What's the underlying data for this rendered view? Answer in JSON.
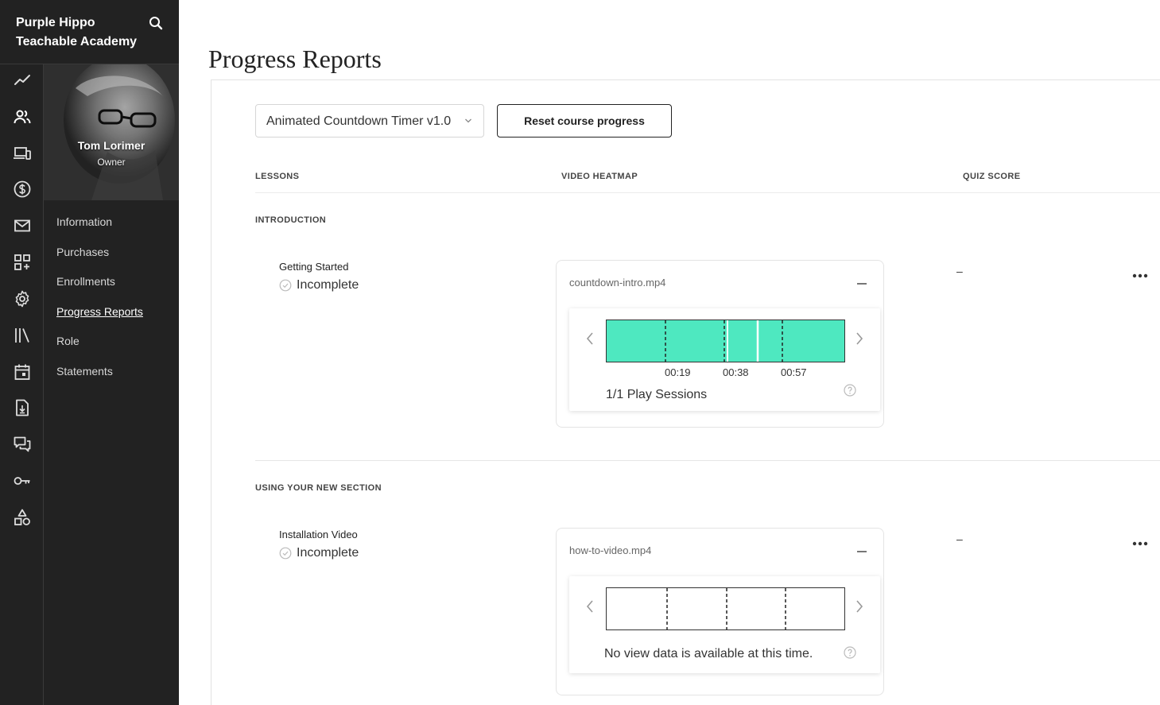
{
  "school": {
    "name": "Purple Hippo Teachable Academy"
  },
  "rail": {
    "items": [
      {
        "icon": "trend-line-icon"
      },
      {
        "icon": "users-icon"
      },
      {
        "icon": "devices-icon"
      },
      {
        "icon": "dollar-icon"
      },
      {
        "icon": "mail-icon"
      },
      {
        "icon": "apps-add-icon"
      },
      {
        "icon": "gear-icon"
      },
      {
        "icon": "library-icon"
      },
      {
        "icon": "calendar-icon"
      },
      {
        "icon": "file-download-icon"
      },
      {
        "icon": "chat-icon"
      },
      {
        "icon": "key-icon"
      },
      {
        "icon": "shapes-icon"
      }
    ]
  },
  "profile": {
    "name": "Tom Lorimer",
    "role": "Owner"
  },
  "subnav": {
    "items": [
      {
        "label": "Information"
      },
      {
        "label": "Purchases"
      },
      {
        "label": "Enrollments"
      },
      {
        "label": "Progress Reports",
        "active": true
      },
      {
        "label": "Role"
      },
      {
        "label": "Statements"
      }
    ]
  },
  "page": {
    "title": "Progress Reports"
  },
  "controls": {
    "course_selected": "Animated Countdown Timer v1.0",
    "reset_label": "Reset course progress"
  },
  "columns": {
    "lessons": "LESSONS",
    "heatmap": "VIDEO HEATMAP",
    "quiz": "QUIZ SCORE"
  },
  "sections": [
    {
      "title": "INTRODUCTION",
      "lessons": [
        {
          "name": "Getting Started",
          "status": "Incomplete",
          "video": {
            "file": "countdown-intro.mp4",
            "has_data": true,
            "ticks": [
              "00:19",
              "00:38",
              "00:57"
            ],
            "sessions_text": "1/1 Play Sessions"
          },
          "quiz_score": "–"
        }
      ]
    },
    {
      "title": "USING YOUR NEW SECTION",
      "lessons": [
        {
          "name": "Installation Video",
          "status": "Incomplete",
          "video": {
            "file": "how-to-video.mp4",
            "has_data": false,
            "nodata_text": "No view data is available at this time."
          },
          "quiz_score": "–"
        }
      ]
    }
  ],
  "colors": {
    "heat": "#4ee8c0",
    "sidebar": "#222222"
  }
}
